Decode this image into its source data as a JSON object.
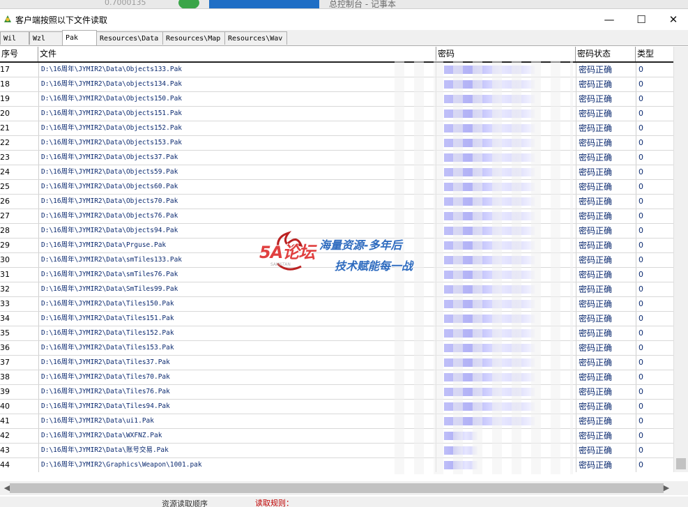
{
  "window": {
    "title": "客户端按照以下文件读取",
    "background_app": "总控制台 - 记事本",
    "background_number": "0.7000135",
    "minimize_icon": "—",
    "maximize_icon": "☐",
    "close_icon": "✕"
  },
  "tabs": [
    {
      "label": "Wil",
      "active": false
    },
    {
      "label": "Wzl",
      "active": false
    },
    {
      "label": "Pak",
      "active": true
    },
    {
      "label": "Resources\\Data",
      "active": false
    },
    {
      "label": "Resources\\Map",
      "active": false
    },
    {
      "label": "Resources\\Wav",
      "active": false
    }
  ],
  "columns": {
    "no": "序号",
    "file": "文件",
    "password": "密码",
    "status": "密码状态",
    "type": "类型"
  },
  "rows": [
    {
      "no": "17",
      "file": "D:\\16周年\\JYMIR2\\Data\\Objects133.Pak",
      "status": "密码正确",
      "type": "0"
    },
    {
      "no": "18",
      "file": "D:\\16周年\\JYMIR2\\Data\\objects134.Pak",
      "status": "密码正确",
      "type": "0"
    },
    {
      "no": "19",
      "file": "D:\\16周年\\JYMIR2\\Data\\Objects150.Pak",
      "status": "密码正确",
      "type": "0"
    },
    {
      "no": "20",
      "file": "D:\\16周年\\JYMIR2\\Data\\Objects151.Pak",
      "status": "密码正确",
      "type": "0"
    },
    {
      "no": "21",
      "file": "D:\\16周年\\JYMIR2\\Data\\Objects152.Pak",
      "status": "密码正确",
      "type": "0"
    },
    {
      "no": "22",
      "file": "D:\\16周年\\JYMIR2\\Data\\Objects153.Pak",
      "status": "密码正确",
      "type": "0"
    },
    {
      "no": "23",
      "file": "D:\\16周年\\JYMIR2\\Data\\Objects37.Pak",
      "status": "密码正确",
      "type": "0"
    },
    {
      "no": "24",
      "file": "D:\\16周年\\JYMIR2\\Data\\Objects59.Pak",
      "status": "密码正确",
      "type": "0"
    },
    {
      "no": "25",
      "file": "D:\\16周年\\JYMIR2\\Data\\Objects60.Pak",
      "status": "密码正确",
      "type": "0"
    },
    {
      "no": "26",
      "file": "D:\\16周年\\JYMIR2\\Data\\Objects70.Pak",
      "status": "密码正确",
      "type": "0"
    },
    {
      "no": "27",
      "file": "D:\\16周年\\JYMIR2\\Data\\Objects76.Pak",
      "status": "密码正确",
      "type": "0"
    },
    {
      "no": "28",
      "file": "D:\\16周年\\JYMIR2\\Data\\Objects94.Pak",
      "status": "密码正确",
      "type": "0"
    },
    {
      "no": "29",
      "file": "D:\\16周年\\JYMIR2\\Data\\Prguse.Pak",
      "status": "密码正确",
      "type": "0"
    },
    {
      "no": "30",
      "file": "D:\\16周年\\JYMIR2\\Data\\smTiles133.Pak",
      "status": "密码正确",
      "type": "0"
    },
    {
      "no": "31",
      "file": "D:\\16周年\\JYMIR2\\Data\\smTiles76.Pak",
      "status": "密码正确",
      "type": "0"
    },
    {
      "no": "32",
      "file": "D:\\16周年\\JYMIR2\\Data\\SmTiles99.Pak",
      "status": "密码正确",
      "type": "0"
    },
    {
      "no": "33",
      "file": "D:\\16周年\\JYMIR2\\Data\\Tiles150.Pak",
      "status": "密码正确",
      "type": "0"
    },
    {
      "no": "34",
      "file": "D:\\16周年\\JYMIR2\\Data\\Tiles151.Pak",
      "status": "密码正确",
      "type": "0"
    },
    {
      "no": "35",
      "file": "D:\\16周年\\JYMIR2\\Data\\Tiles152.Pak",
      "status": "密码正确",
      "type": "0"
    },
    {
      "no": "36",
      "file": "D:\\16周年\\JYMIR2\\Data\\Tiles153.Pak",
      "status": "密码正确",
      "type": "0"
    },
    {
      "no": "37",
      "file": "D:\\16周年\\JYMIR2\\Data\\Tiles37.Pak",
      "status": "密码正确",
      "type": "0"
    },
    {
      "no": "38",
      "file": "D:\\16周年\\JYMIR2\\Data\\Tiles70.Pak",
      "status": "密码正确",
      "type": "0"
    },
    {
      "no": "39",
      "file": "D:\\16周年\\JYMIR2\\Data\\Tiles76.Pak",
      "status": "密码正确",
      "type": "0"
    },
    {
      "no": "40",
      "file": "D:\\16周年\\JYMIR2\\Data\\Tiles94.Pak",
      "status": "密码正确",
      "type": "0"
    },
    {
      "no": "41",
      "file": "D:\\16周年\\JYMIR2\\Data\\ui1.Pak",
      "status": "密码正确",
      "type": "0"
    },
    {
      "no": "42",
      "file": "D:\\16周年\\JYMIR2\\Data\\WXFNZ.Pak",
      "status": "密码正确",
      "type": "0"
    },
    {
      "no": "43",
      "file": "D:\\16周年\\JYMIR2\\Data\\账号交易.Pak",
      "status": "密码正确",
      "type": "0"
    },
    {
      "no": "44",
      "file": "D:\\16周年\\JYMIR2\\Graphics\\Weapon\\1001.pak",
      "status": "密码正确",
      "type": "0"
    }
  ],
  "watermark": {
    "logo": "5A论坛",
    "sub": "SAMSTAN",
    "line1": "海量资源-多年后",
    "line2": "技术赋能每一战"
  },
  "footer": {
    "left_text": "资源读取顺序",
    "rule_label": "读取规则："
  },
  "colors": {
    "link_text": "#0b2a70",
    "password_blur": "#a9a9f5",
    "rule_label": "#c00000"
  }
}
